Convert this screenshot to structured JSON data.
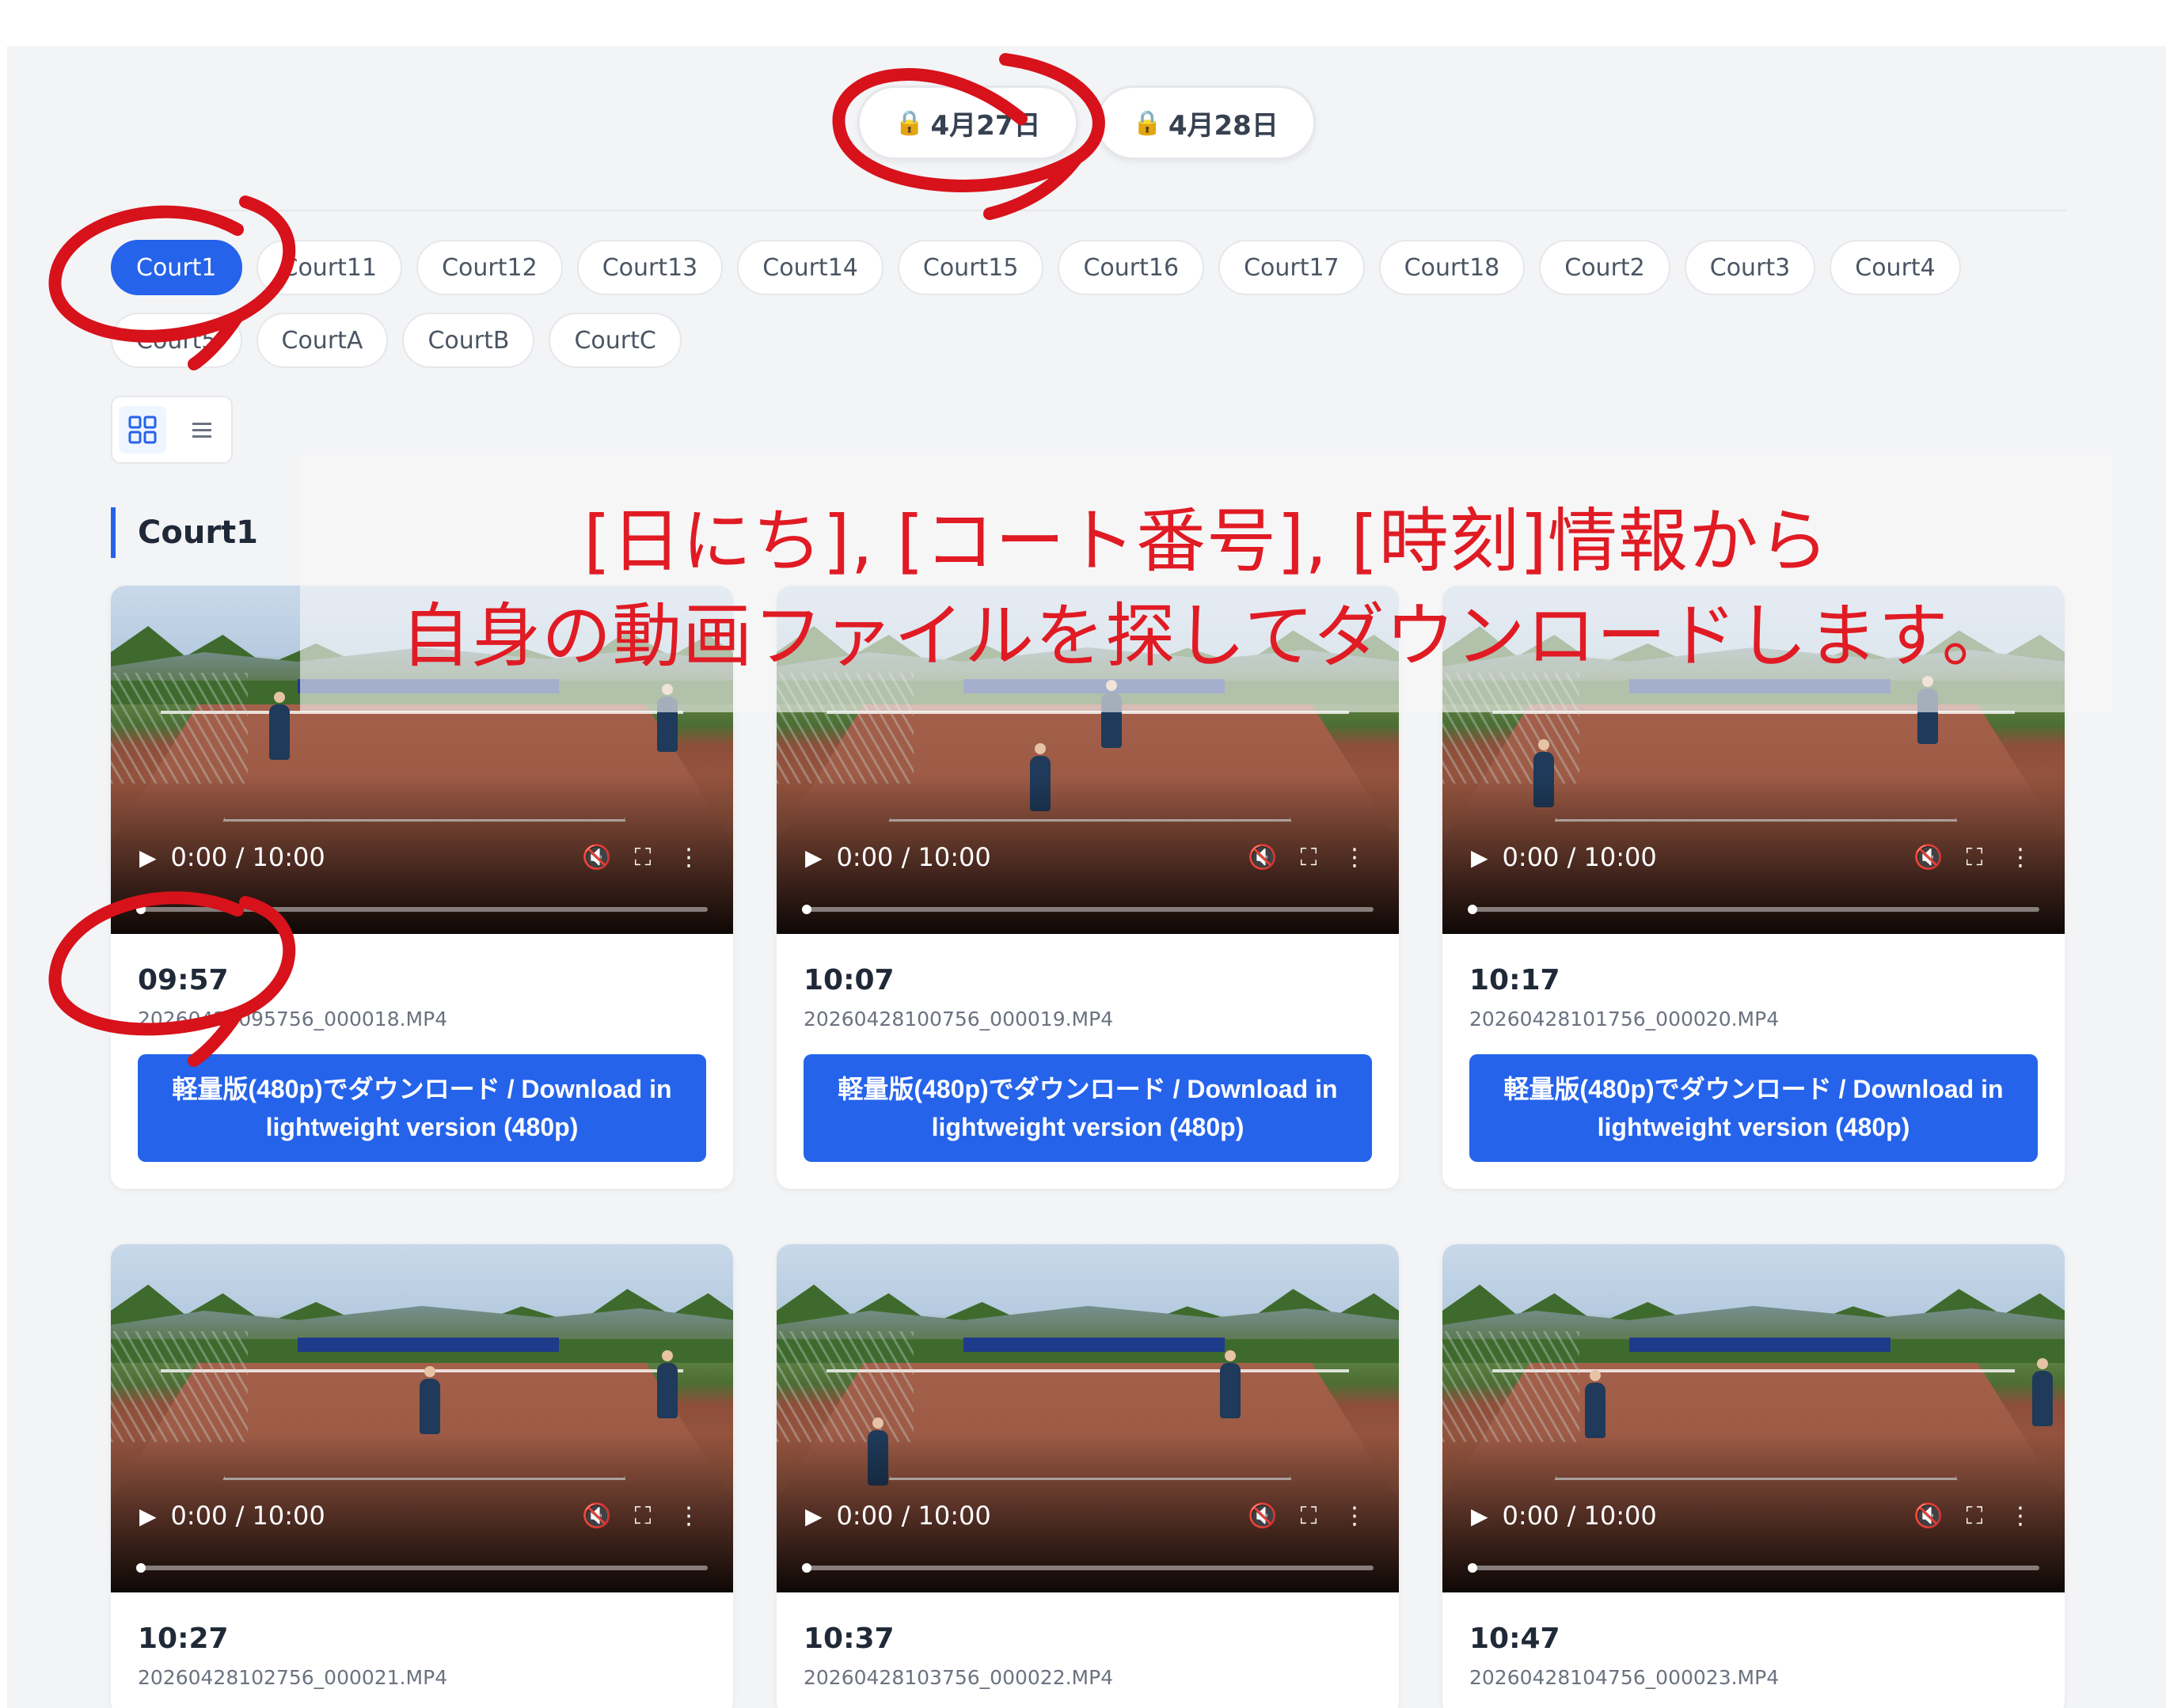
{
  "date_tabs": [
    {
      "label": "4月27日",
      "icon": "lock-icon",
      "lock_glyph": "🔒"
    },
    {
      "label": "4月28日",
      "icon": "lock-icon",
      "lock_glyph": "🔒"
    }
  ],
  "courts": [
    "Court1",
    "Court11",
    "Court12",
    "Court13",
    "Court14",
    "Court15",
    "Court16",
    "Court17",
    "Court18",
    "Court2",
    "Court3",
    "Court4",
    "Court5",
    "CourtA",
    "CourtB",
    "CourtC"
  ],
  "active_court": "Court1",
  "view_toggle": {
    "grid_icon": "grid-view-icon",
    "list_icon": "list-view-icon",
    "list_glyph": "☰"
  },
  "section_title": "Court1",
  "annotation": {
    "line1": "[日にち], [コート番号], [時刻]情報から",
    "line2": "自身の動画ファイルを探してダウンロードします。",
    "color": "#e01b24"
  },
  "video_controls": {
    "time_display": "0:00 / 10:00",
    "play_glyph": "▶",
    "mute_glyph": "🔇",
    "fullscreen_glyph": "⛶",
    "menu_glyph": "⋮"
  },
  "download_label_line1": "軽量版(480p)でダウンロード / Download in",
  "download_label_line2": "lightweight version (480p)",
  "videos": [
    {
      "time": "09:57",
      "file": "20260428095756_000018.MP4"
    },
    {
      "time": "10:07",
      "file": "20260428100756_000019.MP4"
    },
    {
      "time": "10:17",
      "file": "20260428101756_000020.MP4"
    },
    {
      "time": "10:27",
      "file": "20260428102756_000021.MP4"
    },
    {
      "time": "10:37",
      "file": "20260428103756_000022.MP4"
    },
    {
      "time": "10:47",
      "file": "20260428104756_000023.MP4"
    }
  ],
  "colors": {
    "accent": "#2563eb",
    "background": "#f3f4f6",
    "annotation_red": "#e01b24"
  }
}
